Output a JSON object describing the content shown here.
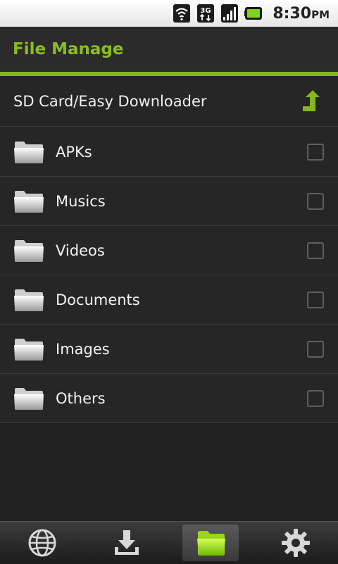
{
  "status_bar": {
    "time": "8:30",
    "time_suffix": "PM",
    "icons": [
      "wifi-icon",
      "3g-icon",
      "signal-icon",
      "battery-icon"
    ]
  },
  "header": {
    "title": "File Manage",
    "accent": "#84b81c"
  },
  "path": {
    "text": "SD Card/Easy Downloader"
  },
  "folders": [
    {
      "label": "APKs"
    },
    {
      "label": "Musics"
    },
    {
      "label": "Videos"
    },
    {
      "label": "Documents"
    },
    {
      "label": "Images"
    },
    {
      "label": "Others"
    }
  ],
  "tabs": [
    {
      "icon": "globe-icon"
    },
    {
      "icon": "download-icon"
    },
    {
      "icon": "folder-icon",
      "active": true
    },
    {
      "icon": "gear-icon"
    }
  ]
}
